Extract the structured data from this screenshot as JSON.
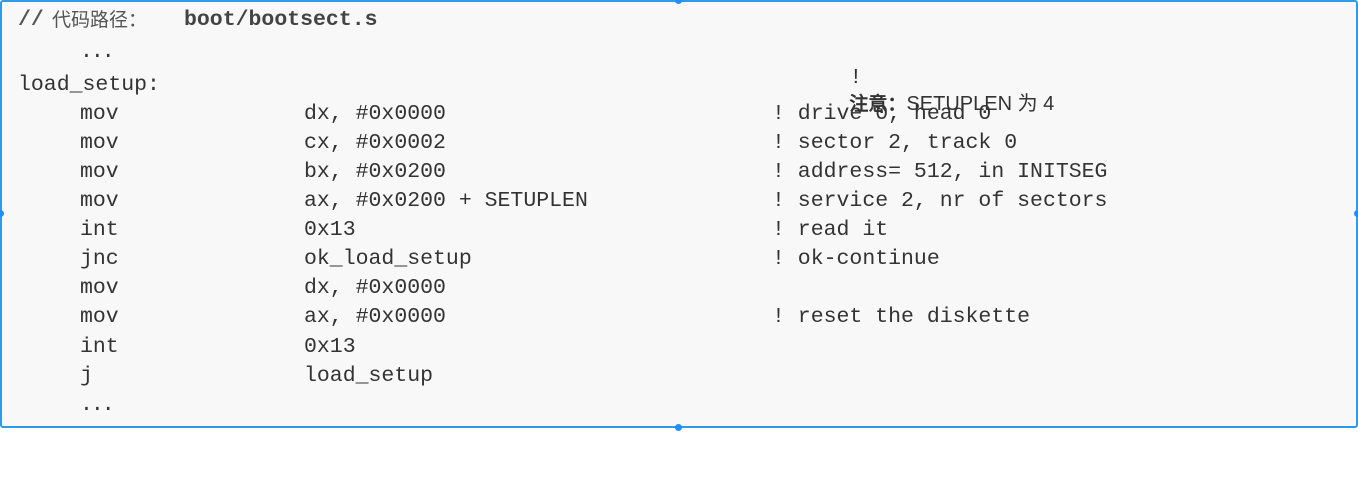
{
  "header": {
    "comment_mark": "//",
    "path_label": "代码路径：",
    "path": "boot/bootsect.s"
  },
  "ellipsis": "...",
  "note": {
    "bang": "!",
    "label": "注意：",
    "text": "SETUPLEN 为 4"
  },
  "label": "load_setup:",
  "instructions": [
    {
      "op": "mov",
      "args": "dx, #0x0000",
      "comment": "! drive 0, head 0"
    },
    {
      "op": "mov",
      "args": "cx, #0x0002",
      "comment": "! sector 2, track 0"
    },
    {
      "op": "mov",
      "args": "bx, #0x0200",
      "comment": "! address= 512, in INITSEG"
    },
    {
      "op": "mov",
      "args": "ax, #0x0200 + SETUPLEN",
      "comment": "! service 2, nr of sectors"
    },
    {
      "op": "int",
      "args": "0x13",
      "comment": "! read it"
    },
    {
      "op": "jnc",
      "args": "ok_load_setup",
      "comment": "! ok-continue"
    },
    {
      "op": "mov",
      "args": "dx, #0x0000",
      "comment": ""
    },
    {
      "op": "mov",
      "args": "ax, #0x0000",
      "comment": "! reset the diskette"
    },
    {
      "op": "int",
      "args": "0x13",
      "comment": ""
    },
    {
      "op": "j",
      "args": "load_setup",
      "comment": ""
    }
  ]
}
